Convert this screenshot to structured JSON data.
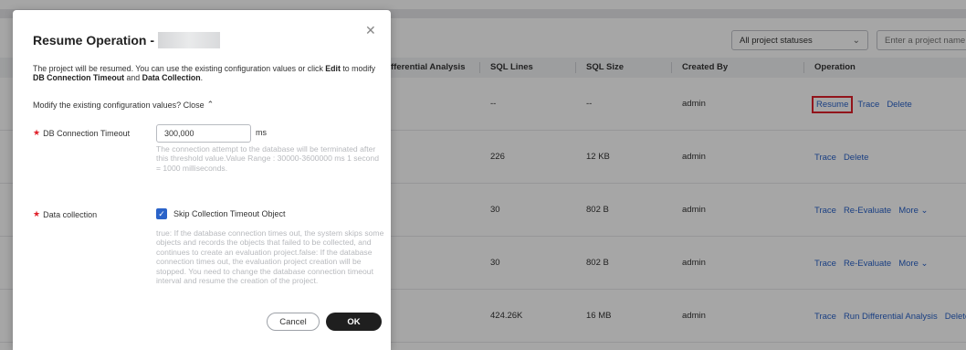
{
  "toolbar": {
    "status_select": "All project statuses",
    "search_placeholder": "Enter a project name."
  },
  "table": {
    "columns": [
      "fferential Analysis",
      "SQL Lines",
      "SQL Size",
      "Created By",
      "Operation"
    ],
    "rows": [
      {
        "sql_lines": "--",
        "sql_size": "--",
        "created_by": "admin",
        "ops": [
          "Resume",
          "Trace",
          "Delete"
        ]
      },
      {
        "sql_lines": "226",
        "sql_size": "12 KB",
        "created_by": "admin",
        "ops": [
          "Trace",
          "Delete"
        ]
      },
      {
        "sql_lines": "30",
        "sql_size": "802 B",
        "created_by": "admin",
        "ops": [
          "Trace",
          "Re-Evaluate",
          "More"
        ]
      },
      {
        "sql_lines": "30",
        "sql_size": "802 B",
        "created_by": "admin",
        "ops": [
          "Trace",
          "Re-Evaluate",
          "More"
        ]
      },
      {
        "sql_lines": "424.26K",
        "sql_size": "16 MB",
        "created_by": "admin",
        "ops": [
          "Trace",
          "Run Differential Analysis",
          "Delete"
        ]
      }
    ]
  },
  "modal": {
    "title": "Resume Operation -",
    "desc_part1": "The project will be resumed. You can use the existing configuration values or click ",
    "desc_edit": "Edit",
    "desc_part2": " to modify ",
    "desc_db_timeout": "DB Connection Timeout",
    "desc_and": " and ",
    "desc_data_collection": "Data Collection",
    "desc_end": ".",
    "modify_text": "Modify the existing configuration values?",
    "close_link": "Close",
    "db_timeout_label": "DB Connection Timeout",
    "db_timeout_value": "300,000",
    "db_timeout_unit": "ms",
    "db_timeout_hint": "The connection attempt to the database will be terminated after this threshold value.Value Range : 30000-3600000 ms 1 second = 1000 milliseconds.",
    "data_collection_label": "Data collection",
    "skip_label": "Skip Collection Timeout Object",
    "skip_hint": "true: If the database connection times out, the system skips some objects and records the objects that failed to be collected, and continues to create an evaluation project.false: If the database connection times out, the evaluation project creation will be stopped. You need to change the database connection timeout interval and resume the creation of the project.",
    "cancel_label": "Cancel",
    "ok_label": "OK"
  }
}
